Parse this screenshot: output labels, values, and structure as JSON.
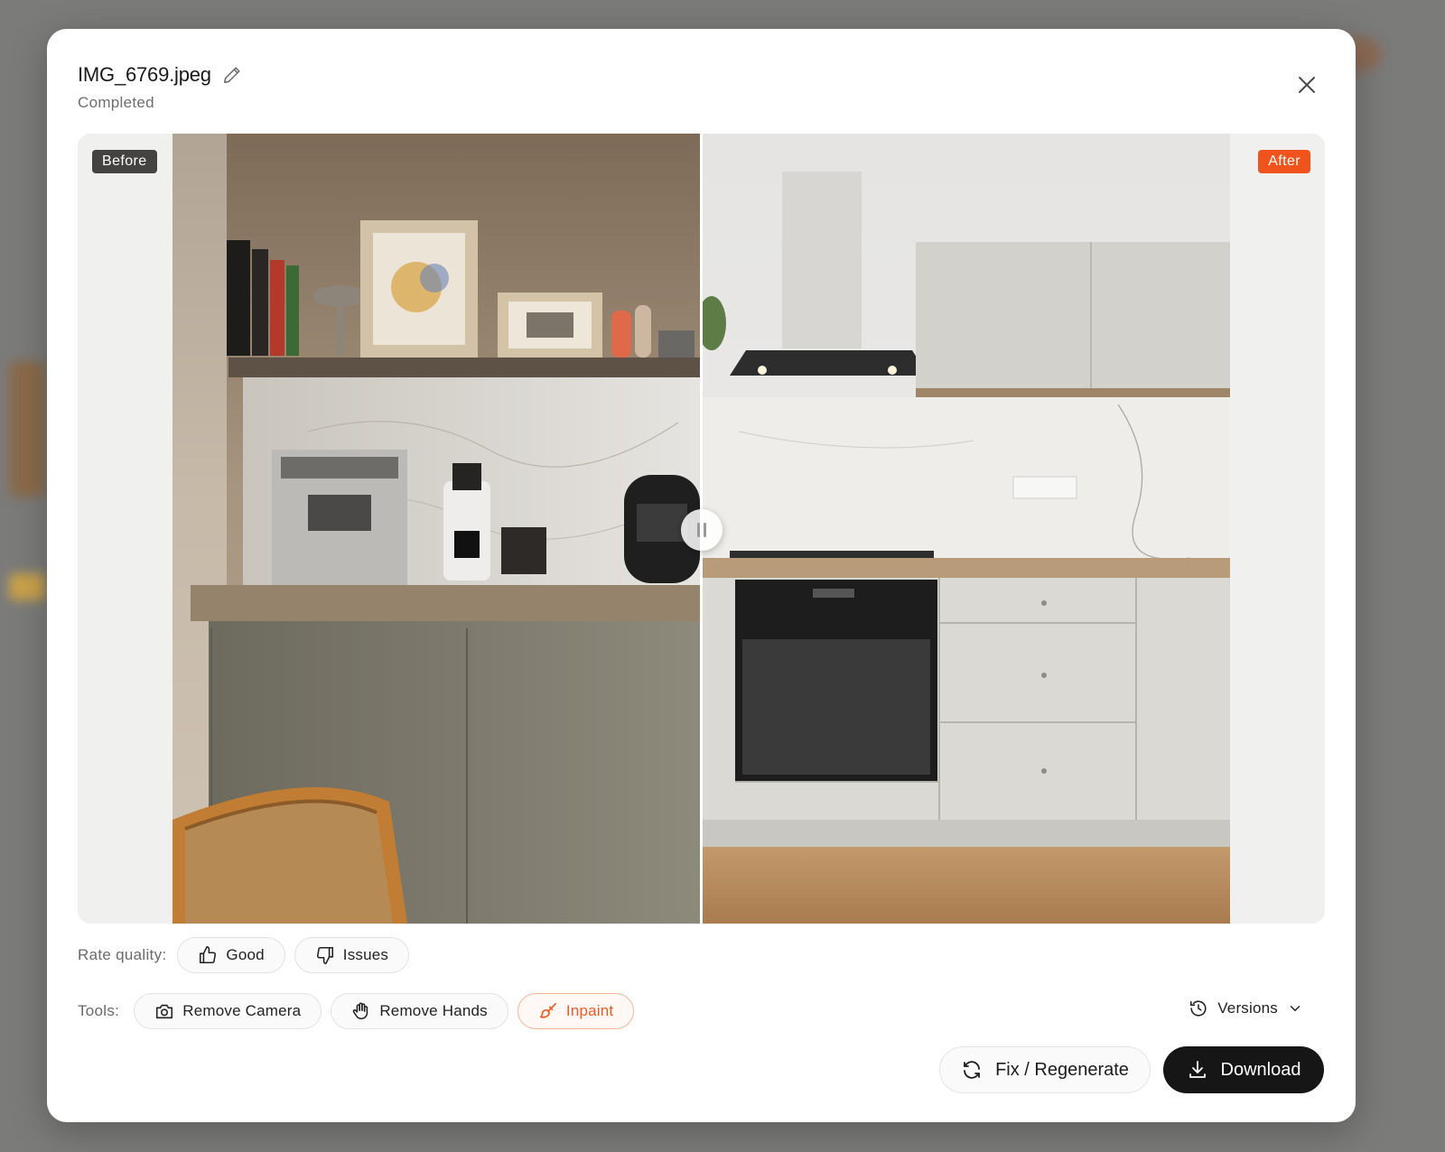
{
  "modal": {
    "file_name": "IMG_6769.jpeg",
    "status": "Completed"
  },
  "compare": {
    "before_label": "Before",
    "after_label": "After",
    "split_position": 0.5
  },
  "rating": {
    "label": "Rate quality:",
    "good_label": "Good",
    "issues_label": "Issues"
  },
  "tools": {
    "label": "Tools:",
    "remove_camera_label": "Remove Camera",
    "remove_hands_label": "Remove Hands",
    "inpaint_label": "Inpaint"
  },
  "versions": {
    "label": "Versions"
  },
  "actions": {
    "regenerate_label": "Fix / Regenerate",
    "download_label": "Download"
  },
  "colors": {
    "accent": "#f0531c",
    "primary_button": "#161616",
    "before_tag": "#444341"
  },
  "icons": {
    "edit": "pencil-icon",
    "close": "close-icon",
    "good": "thumbs-up-icon",
    "issues": "thumbs-down-icon",
    "remove_camera": "camera-icon",
    "remove_hands": "hand-icon",
    "inpaint": "brush-icon",
    "versions": "history-icon",
    "versions_toggle": "chevron-down-icon",
    "regenerate": "refresh-icon",
    "download": "download-icon"
  }
}
